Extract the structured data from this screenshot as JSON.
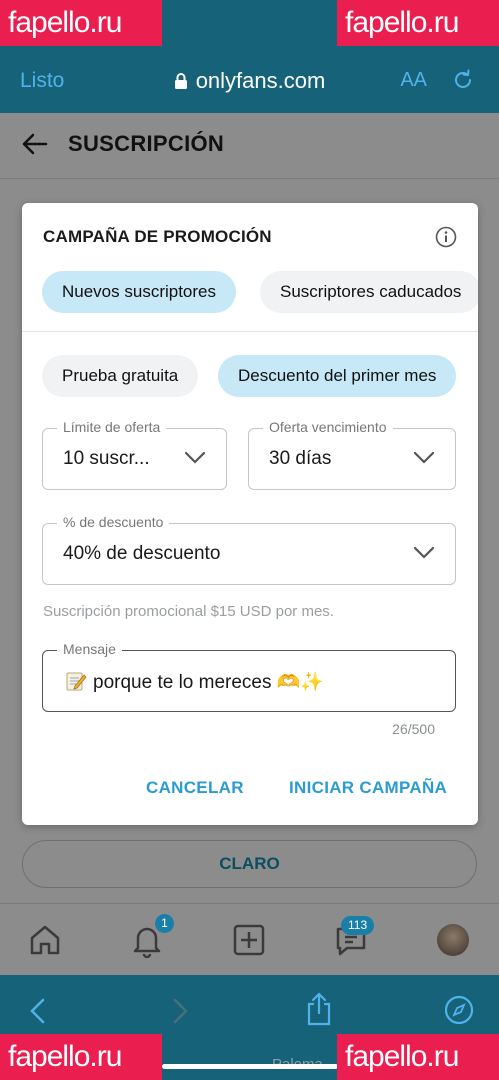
{
  "watermark": "fapello.ru",
  "browser": {
    "done_label": "Listo",
    "url": "onlyfans.com",
    "text_size_label": "AA"
  },
  "page": {
    "title": "SUSCRIPCIÓN",
    "clear_button": "CLARO",
    "tabbar": {
      "notification_count": "1",
      "messages_count": "113"
    },
    "footer_name": "Paloma"
  },
  "dialog": {
    "title": "CAMPAÑA DE PROMOCIÓN",
    "audience_tabs": [
      {
        "label": "Nuevos suscriptores",
        "active": true
      },
      {
        "label": "Suscriptores caducados",
        "active": false
      }
    ],
    "type_tabs": [
      {
        "label": "Prueba gratuita",
        "active": false
      },
      {
        "label": "Descuento del primer mes",
        "active": true
      }
    ],
    "offer_limit": {
      "label": "Límite de oferta",
      "value": "10 suscr..."
    },
    "offer_expiration": {
      "label": "Oferta vencimiento",
      "value": "30 días"
    },
    "discount": {
      "label": "% de descuento",
      "value": "40% de descuento"
    },
    "helper_text": "Suscripción promocional $15 USD por mes.",
    "message": {
      "label": "Mensaje",
      "value": "porque te lo mereces 🫶✨"
    },
    "char_counter": "26/500",
    "cancel_label": "CANCELAR",
    "start_label": "INICIAR CAMPAÑA"
  },
  "colors": {
    "bar": "#166379",
    "accent": "#2a9cd1",
    "pill_active": "#c7e8f6",
    "watermark": "#ea1e4f"
  }
}
